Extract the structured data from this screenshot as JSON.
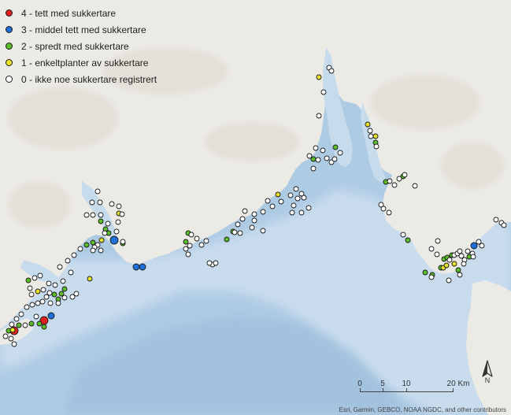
{
  "legend": {
    "items": [
      {
        "label": "4 - tett med sukkertare",
        "color": "#e0201e"
      },
      {
        "label": "3 - middel tett med sukkertare",
        "color": "#1e6fd9"
      },
      {
        "label": "2 - spredt med sukkertare",
        "color": "#5cbf2a"
      },
      {
        "label": "1 - enkeltplanter av sukkertare",
        "color": "#e9e22a"
      },
      {
        "label": "0 - ikke noe sukkertare registrert",
        "color": "#ffffff"
      }
    ]
  },
  "scalebar": {
    "labels": [
      "0",
      "5",
      "10",
      "20 Km"
    ]
  },
  "north_arrow": {
    "label": "N",
    "icon": "north-arrow-icon"
  },
  "attribution": "Esri, Garmin, GEBCO, NOAA NGDC, and other contributors",
  "colors": {
    "land": "#eceae5",
    "land_hills": "#dfdcd4",
    "shelf_water": "#c8dced",
    "deep_water": "#aecbe4",
    "coastal_water": "#d8e6f1"
  }
}
